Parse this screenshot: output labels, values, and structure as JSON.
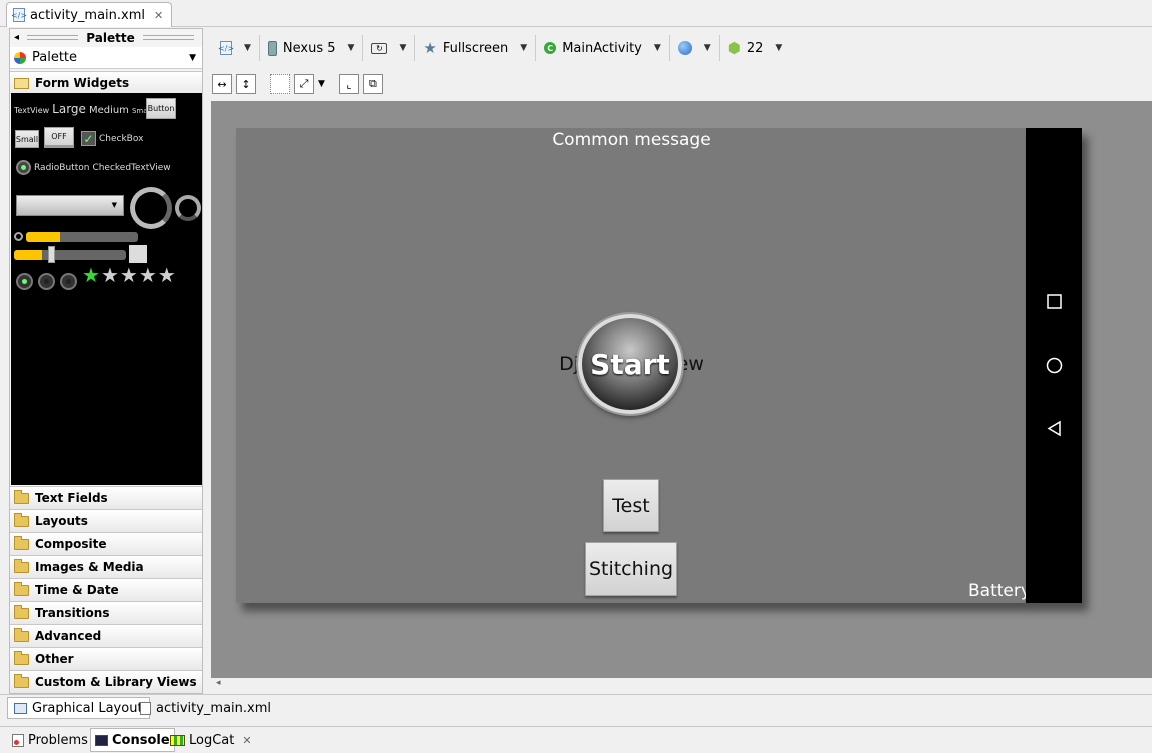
{
  "editor": {
    "file_tab": "activity_main.xml"
  },
  "palette": {
    "header": "Palette",
    "selector": "Palette",
    "open_category": "Form Widgets",
    "categories": [
      "Text Fields",
      "Layouts",
      "Composite",
      "Images & Media",
      "Time & Date",
      "Transitions",
      "Advanced",
      "Other",
      "Custom & Library Views"
    ],
    "widgets": {
      "textview": "TextView",
      "large": "Large",
      "medium": "Medium",
      "small": "Small",
      "button": "Button",
      "small_button": "Small",
      "toggle": "OFF",
      "checkbox": "CheckBox",
      "radiobutton": "RadioButton",
      "checkedtextview": "CheckedTextView",
      "progress_fraction": 0.3,
      "seekbar_fraction": 0.25,
      "rating_stars": 1,
      "rating_max": 5
    }
  },
  "toolbar": {
    "device": "Nexus 5",
    "theme": "Fullscreen",
    "activity": "MainActivity",
    "api_level": "22"
  },
  "preview": {
    "common_message": "Common message",
    "dji_view": "DjiCameraView",
    "start_button": "Start",
    "test_button": "Test",
    "stitching_button": "Stitching",
    "battery": "Battery"
  },
  "bottom_tabs": {
    "graphical": "Graphical Layout",
    "xml": "activity_main.xml"
  },
  "console_tabs": {
    "problems": "Problems",
    "console": "Console",
    "logcat": "LogCat"
  },
  "colors": {
    "canvas": "#8e8e8e",
    "device": "#7a7a7a",
    "navbar": "#000000",
    "accent": "#ffc400"
  }
}
